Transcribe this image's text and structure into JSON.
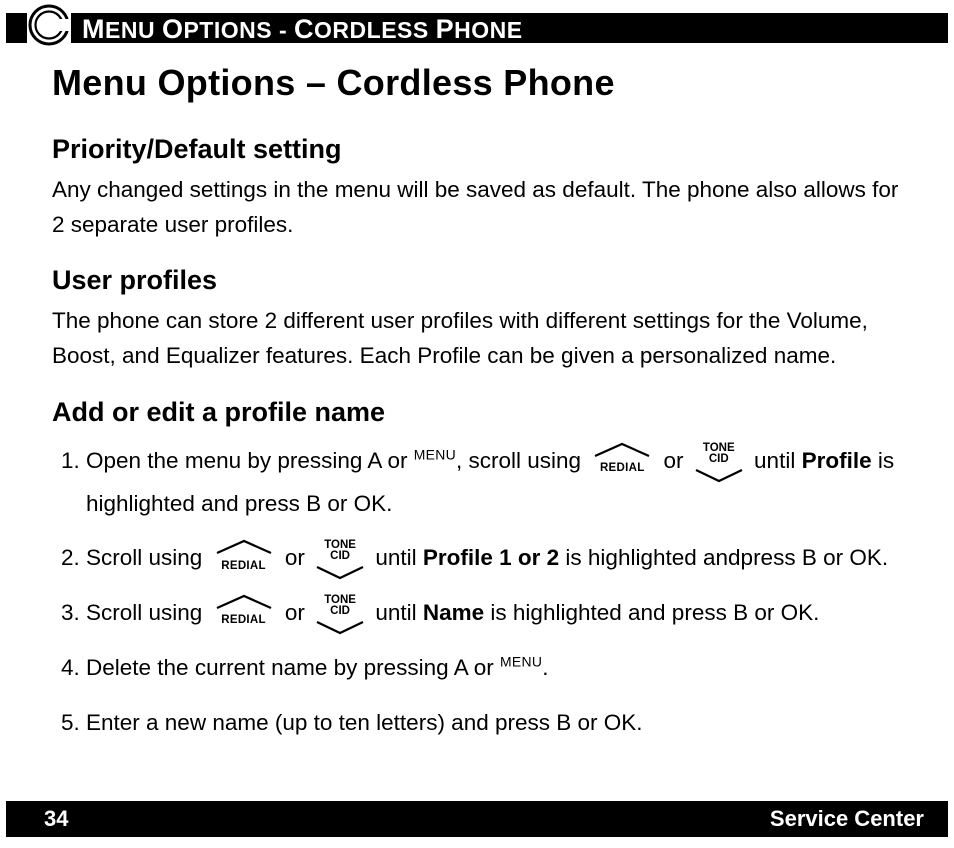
{
  "header": {
    "chapter_title_html": "<span class='cap'>M</span>ENU <span class='cap'>O</span>PTIONS - <span class='cap'>C</span>ORDLESS <span class='cap'>P</span>HONE"
  },
  "page_title": "Menu Options – Cordless Phone",
  "s1": {
    "heading": "Priority/Default setting",
    "body": "Any changed settings in the menu will be saved as default. The phone also allows for 2 separate user profiles."
  },
  "s2": {
    "heading": "User profiles",
    "body": "The phone can store 2 different user profiles with different settings for the Volume, Boost, and Equalizer features. Each Profile can be given a personalized name."
  },
  "s3": {
    "heading": "Add or edit a profile name"
  },
  "keys": {
    "redial": "REDIAL",
    "tone_top": "TONE",
    "tone_bottom": "CID",
    "menu": "MENU"
  },
  "steps": {
    "step1a": "Open the menu by pressing A or ",
    "step1b": ", scroll using ",
    "step1c": " or ",
    "step1d": " until ",
    "step1_profile": "Profile",
    "step1e": " is highlighted and press B or OK.",
    "step2a": "Scroll using ",
    "step2b": " or ",
    "step2c": " until ",
    "step2_profile12": "Profile 1 or 2",
    "step2d": " is highlighted andpress B or OK.",
    "step3a": "Scroll using ",
    "step3b": " or ",
    "step3c": " until ",
    "step3_name": "Name",
    "step3d": " is highlighted and press B or OK.",
    "step4a": "Delete the current name by pressing A or ",
    "step4b": ".",
    "step5": "Enter a new name (up to ten letters) and press B or OK."
  },
  "footer": {
    "page": "34",
    "service": "Service Center"
  }
}
